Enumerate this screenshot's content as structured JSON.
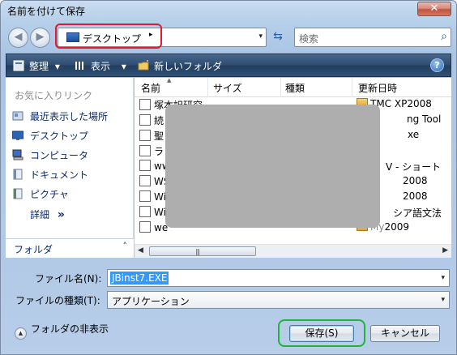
{
  "window": {
    "title": "名前を付けて保存",
    "close_label": "✕"
  },
  "address_bar": {
    "location": "デスクトップ",
    "arrow": "▸",
    "dropdown": "▾",
    "back": "◀",
    "forward": "▶",
    "refresh": "⇆"
  },
  "search": {
    "placeholder": "検索",
    "icon": "⌕"
  },
  "toolbar": {
    "organize": "整理",
    "views": "表示",
    "new_folder": "新しいフォルダ",
    "dropdown": "▾",
    "help": "?"
  },
  "sidebar": {
    "favorites_header": "お気に入りリンク",
    "items": [
      {
        "label": "最近表示した場所",
        "icon": "recent-places-icon"
      },
      {
        "label": "デスクトップ",
        "icon": "desktop-icon"
      },
      {
        "label": "コンピュータ",
        "icon": "computer-icon"
      },
      {
        "label": "ドキュメント",
        "icon": "documents-icon"
      },
      {
        "label": "ピクチャ",
        "icon": "pictures-icon"
      }
    ],
    "details": "詳細",
    "details_chevron": "»",
    "folder_pane": "フォルダ",
    "folder_pane_chevron": "˄"
  },
  "file_list": {
    "columns": [
      "名前",
      "サイズ",
      "種類",
      "更新日時"
    ],
    "sort_caret": "▲",
    "rows": [
      {
        "name": "塚本訳研究",
        "date": "TMC XP2008"
      },
      {
        "name": "続",
        "date": "ng Tool"
      },
      {
        "name": "聖",
        "date": "xe"
      },
      {
        "name": "ラ",
        "date": ""
      },
      {
        "name": "ww",
        "date": "V - ショート"
      },
      {
        "name": "WS",
        "date": "2008"
      },
      {
        "name": "Wi",
        "date": "2008"
      },
      {
        "name": "Wi",
        "date": "シア語文法"
      },
      {
        "name": "we",
        "date": "2009"
      }
    ],
    "scroll_left": "◀",
    "scroll_right": "▶",
    "scroll_grip": "|||"
  },
  "form": {
    "filename_label": "ファイル名(N):",
    "filename_value": "JBinst7.EXE",
    "filetype_label": "ファイルの種類(T):",
    "filetype_value": "アプリケーション",
    "dropdown": "▾"
  },
  "footer": {
    "hide_folders": "フォルダの非表示",
    "hide_icon": "▲",
    "save": "保存(S)",
    "cancel": "キャンセル"
  },
  "colors": {
    "toolbar": "#2e4c70",
    "address_highlight": "#e0192f",
    "save_highlight": "#1fb53a",
    "redaction": "#aeaeae"
  }
}
